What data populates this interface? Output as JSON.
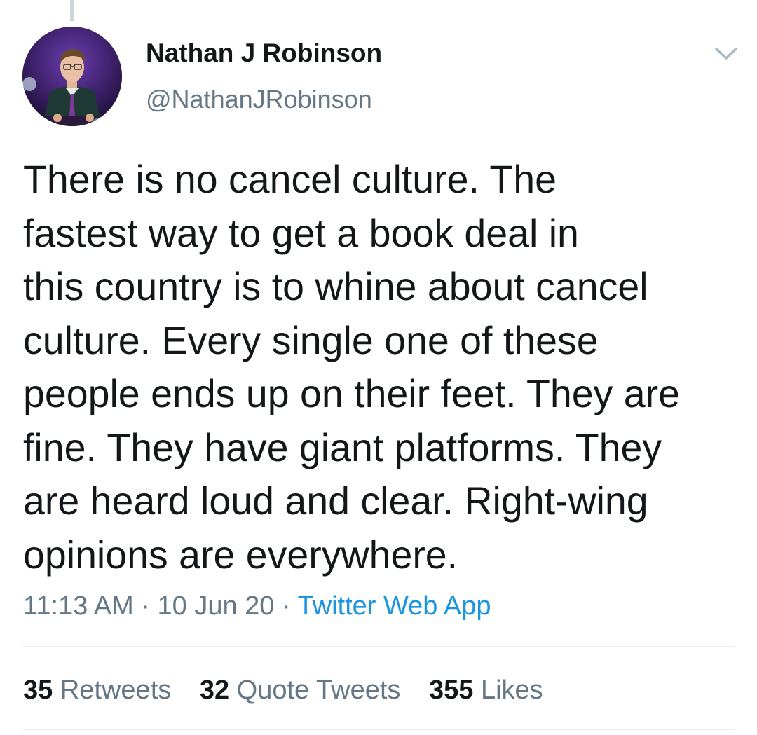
{
  "author": {
    "display_name": "Nathan J Robinson",
    "handle": "@NathanJRobinson"
  },
  "tweet": {
    "text": "There is no cancel culture. The fastest way to get a book deal in this country is to whine about cancel culture. Every single one of these people ends up on their feet. They are fine. They have giant platforms. They are heard loud and clear. Right-wing opinions are everywhere.",
    "lines": [
      "There is no cancel culture. The",
      "fastest way to get a book deal in",
      "this country is to whine about cancel",
      "culture. Every single one of these",
      "people ends up on their feet. They are",
      "fine. They have giant platforms. They",
      "are heard loud and clear. Right-wing",
      "opinions are everywhere."
    ]
  },
  "meta": {
    "time": "11:13 AM",
    "separator": " · ",
    "date": "10 Jun 20",
    "source": "Twitter Web App"
  },
  "stats": {
    "retweets": {
      "count": "35",
      "label": "Retweets"
    },
    "quote_tweets": {
      "count": "32",
      "label": "Quote Tweets"
    },
    "likes": {
      "count": "355",
      "label": "Likes"
    }
  },
  "icons": {
    "caret": "chevron-down-icon"
  },
  "colors": {
    "text_primary": "#14171a",
    "text_secondary": "#657786",
    "link": "#1b95e0",
    "divider": "#e6ecf0"
  }
}
